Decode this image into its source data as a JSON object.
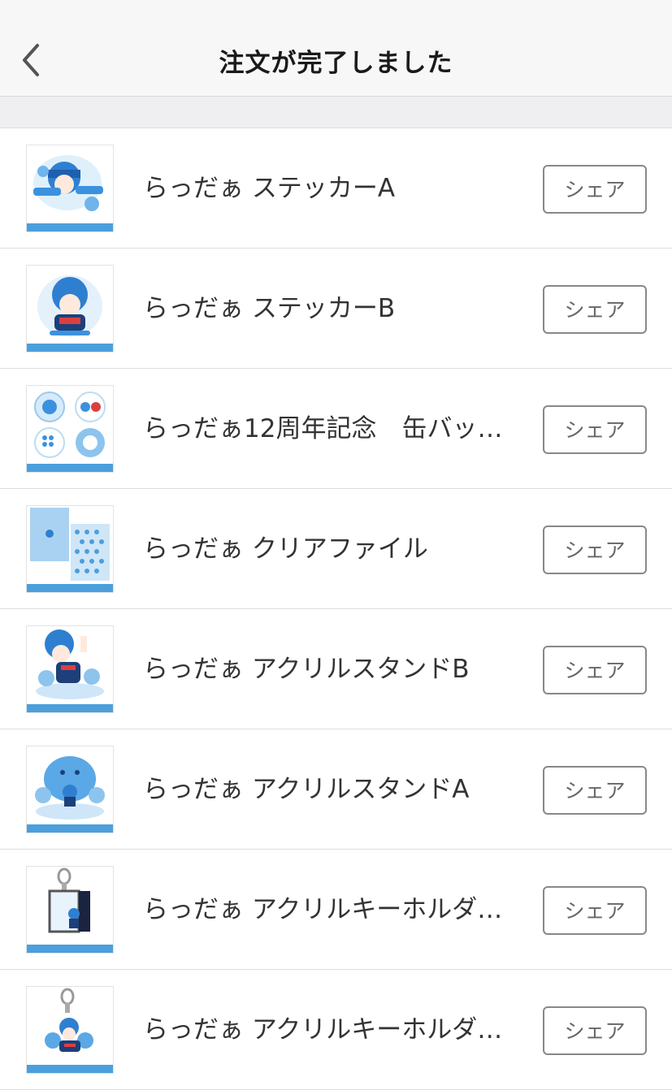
{
  "header": {
    "title": "注文が完了しました",
    "back_icon": "chevron-left-icon"
  },
  "colors": {
    "accent_blue": "#4b9fdc",
    "border": "#888888",
    "text": "#333333"
  },
  "items": [
    {
      "name": "らっだぁ ステッカーA",
      "share_label": "シェア"
    },
    {
      "name": "らっだぁ ステッカーB",
      "share_label": "シェア"
    },
    {
      "name": "らっだぁ12周年記念　缶バッ…",
      "share_label": "シェア"
    },
    {
      "name": "らっだぁ クリアファイル",
      "share_label": "シェア"
    },
    {
      "name": "らっだぁ アクリルスタンドB",
      "share_label": "シェア"
    },
    {
      "name": "らっだぁ アクリルスタンドA",
      "share_label": "シェア"
    },
    {
      "name": "らっだぁ アクリルキーホルダ…",
      "share_label": "シェア"
    },
    {
      "name": "らっだぁ アクリルキーホルダ…",
      "share_label": "シェア"
    }
  ]
}
